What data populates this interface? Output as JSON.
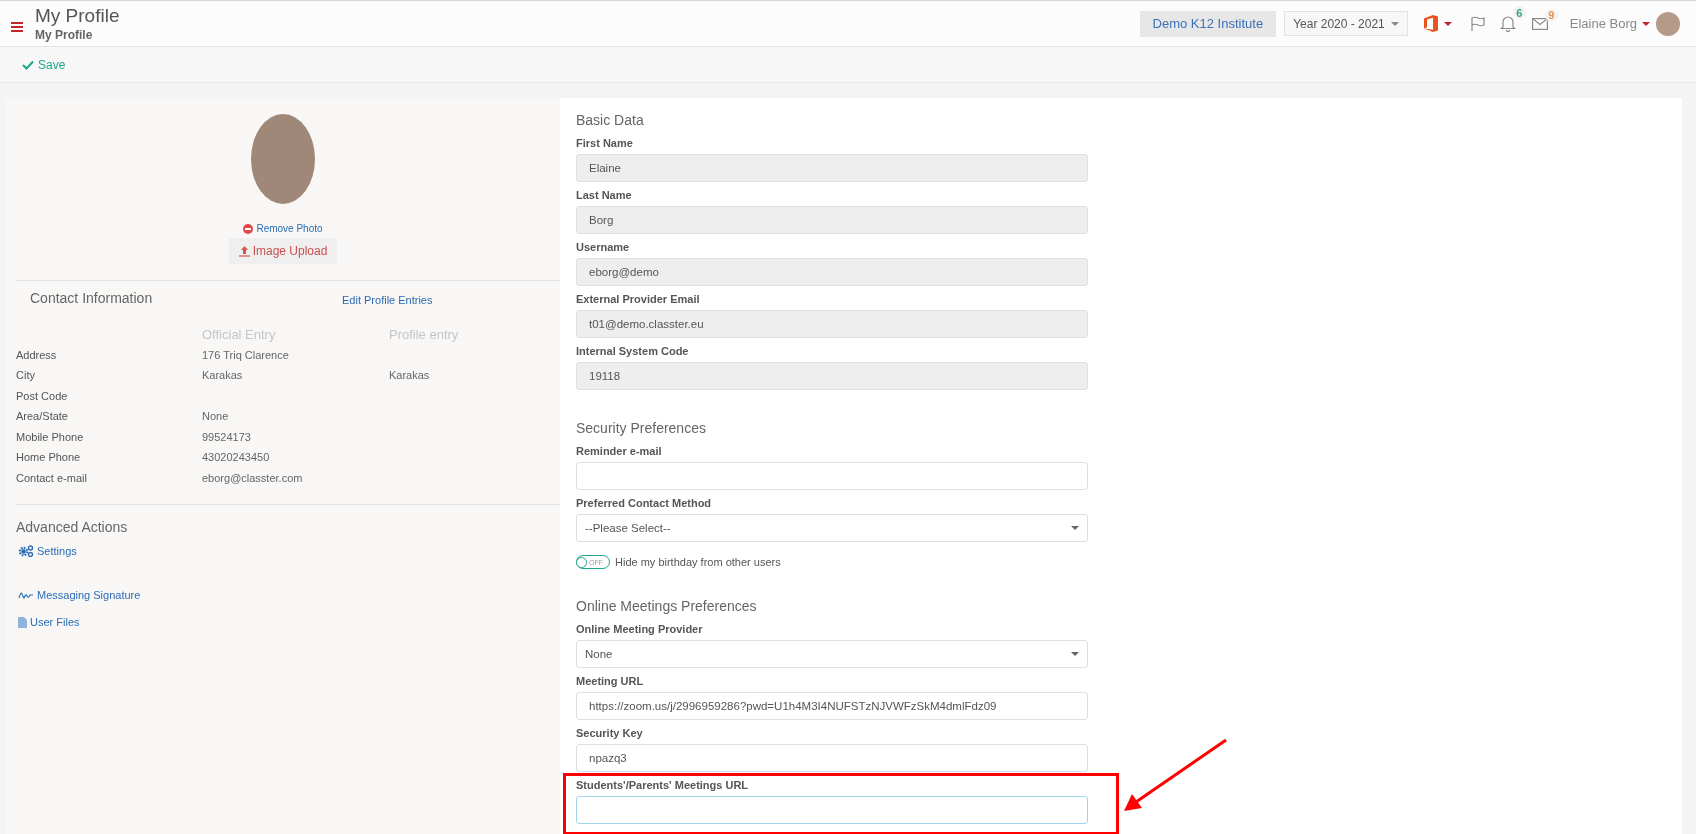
{
  "header": {
    "title": "My Profile",
    "subtitle": "My Profile",
    "institute": "Demo K12 Institute",
    "year": "Year 2020 - 2021",
    "notifications": [
      {
        "kind": "bell",
        "count": "6",
        "color": "#3aa38f"
      },
      {
        "kind": "mail",
        "count": "9",
        "color": "#f0914a"
      }
    ],
    "user_name": "Elaine Borg"
  },
  "toolbar": {
    "save": "Save"
  },
  "profile": {
    "remove_photo": "Remove Photo",
    "image_upload": "Image Upload",
    "contact": {
      "title": "Contact Information",
      "edit_link": "Edit Profile Entries",
      "columns": [
        "Official Entry",
        "Profile entry"
      ],
      "rows": [
        {
          "label": "Address",
          "official": "176 Triq Clarence"
        },
        {
          "label": "City",
          "official": "Karakas",
          "profile": "Karakas"
        },
        {
          "label": "Post Code"
        },
        {
          "label": "Area/State",
          "official": "None"
        },
        {
          "label": "Mobile Phone",
          "official": "99524173"
        },
        {
          "label": "Home Phone",
          "official": "43020243450"
        },
        {
          "label": "Contact e-mail",
          "official": "eborg@classter.com"
        }
      ]
    },
    "advanced": {
      "title": "Advanced Actions",
      "actions": [
        {
          "kind": "settings",
          "label": "Settings"
        },
        {
          "kind": "signature",
          "label": "Messaging Signature"
        },
        {
          "kind": "files",
          "label": "User Files"
        }
      ]
    }
  },
  "sections": [
    {
      "title": "Basic Data",
      "items": [
        {
          "kind": "input",
          "label": "First Name",
          "value": "Elaine",
          "readonly": true
        },
        {
          "kind": "input",
          "label": "Last Name",
          "value": "Borg",
          "readonly": true
        },
        {
          "kind": "input",
          "label": "Username",
          "value": "eborg@demo",
          "readonly": true
        },
        {
          "kind": "input",
          "label": "External Provider Email",
          "value": "t01@demo.classter.eu",
          "readonly": true
        },
        {
          "kind": "input",
          "label": "Internal System Code",
          "value": "19118",
          "readonly": true
        }
      ]
    },
    {
      "title": "Security Preferences",
      "items": [
        {
          "kind": "input",
          "label": "Reminder e-mail",
          "readonly": false
        },
        {
          "kind": "select",
          "label": "Preferred Contact Method",
          "value": "--Please Select--"
        },
        {
          "kind": "toggle",
          "label": "Hide my birthday from other users",
          "state_text": "OFF",
          "on": false
        }
      ]
    },
    {
      "title": "Online Meetings Preferences",
      "items": [
        {
          "kind": "select",
          "label": "Online Meeting Provider",
          "value": "None"
        },
        {
          "kind": "input",
          "label": "Meeting URL",
          "value": "https://zoom.us/j/2996959286?pwd=U1h4M3I4NUFSTzNJVWFzSkM4dmlFdz09",
          "readonly": false
        },
        {
          "kind": "input",
          "label": "Security Key",
          "value": "npazq3",
          "readonly": false
        },
        {
          "kind": "input",
          "label": "Students'/Parents' Meetings URL",
          "readonly": false,
          "focused": true
        }
      ]
    }
  ]
}
